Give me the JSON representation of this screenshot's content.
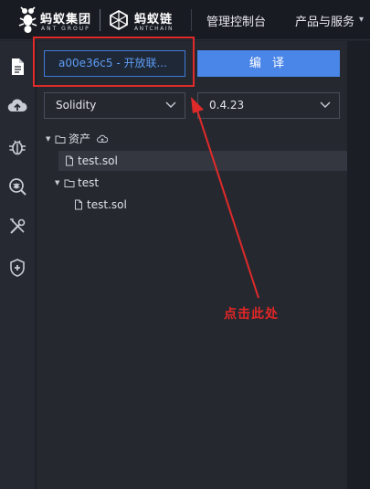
{
  "header": {
    "logo_ant_text": "蚂蚁集团",
    "logo_ant_sub": "ANT GROUP",
    "logo_chain_text": "蚂蚁链",
    "logo_chain_sub": "ANTCHAIN",
    "nav": [
      "管理控制台",
      "产品与服务"
    ]
  },
  "rail": {
    "icons": [
      "file-icon",
      "cloud-upload-icon",
      "bug-icon",
      "search-bug-icon",
      "tools-icon",
      "shield-plus-icon"
    ]
  },
  "panel": {
    "account_label": "a00e36c5 - 开放联...",
    "compile_label": "编 译",
    "language_select": "Solidity",
    "version_select": "0.4.23",
    "tree": [
      {
        "label": "资产",
        "type": "folder"
      },
      {
        "label": "test.sol",
        "type": "file"
      },
      {
        "label": "test",
        "type": "folder"
      },
      {
        "label": "test.sol",
        "type": "file"
      }
    ]
  },
  "annotation": {
    "text": "点击此处",
    "color": "#e32626"
  },
  "colors": {
    "accent": "#4a86e8",
    "annotation_red": "#e02a2a"
  }
}
